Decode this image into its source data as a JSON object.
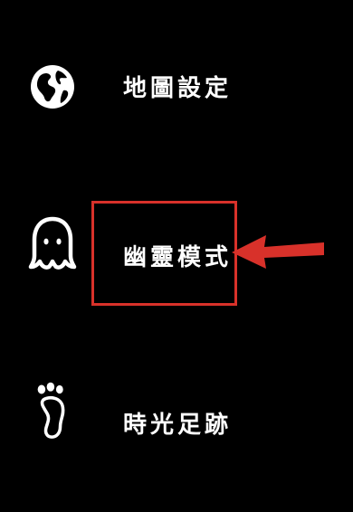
{
  "menu": {
    "items": [
      {
        "id": "map-settings",
        "label": "地圖設定",
        "icon": "globe-icon"
      },
      {
        "id": "ghost-mode",
        "label": "幽靈模式",
        "icon": "ghost-icon"
      },
      {
        "id": "footprints",
        "label": "時光足跡",
        "icon": "footprint-icon"
      }
    ]
  },
  "annotation": {
    "highlight_color": "#d8312a",
    "highlight_target": "ghost-mode",
    "arrow": "arrow-left-icon"
  }
}
